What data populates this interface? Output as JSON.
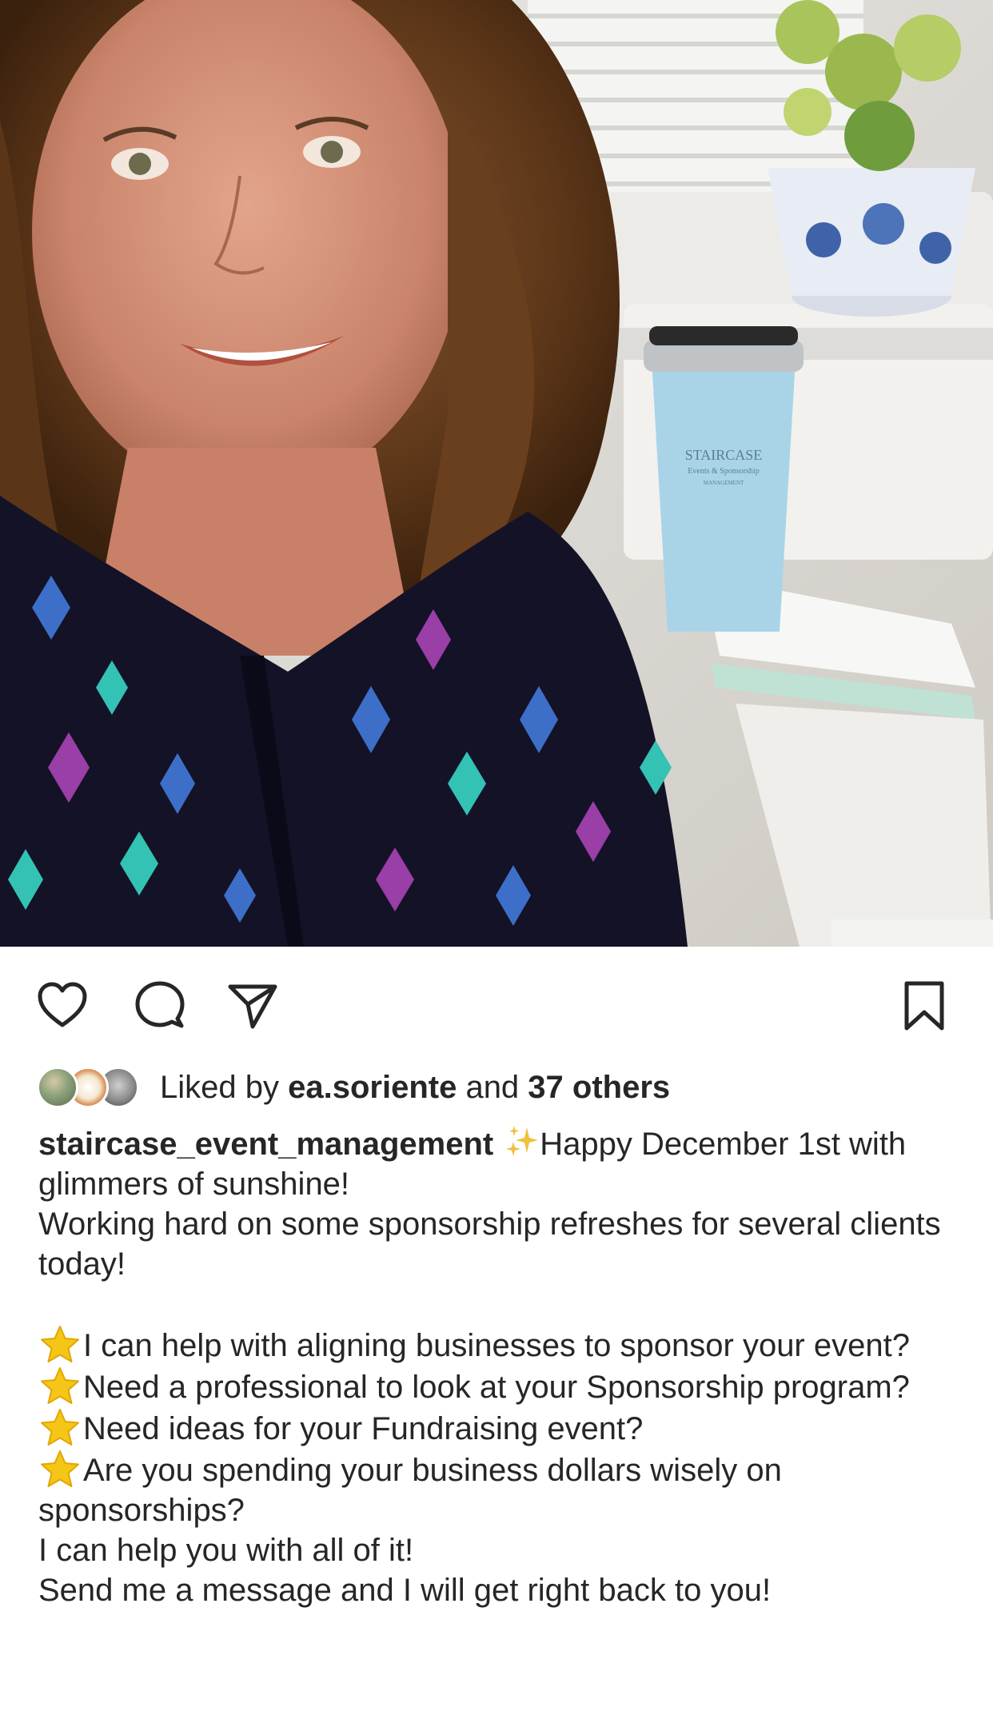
{
  "post": {
    "photo_alt": "",
    "tumbler_brand": "STAIRCASE",
    "tumbler_subline": "Events & Sponsorship",
    "tumbler_footer": "MANAGEMENT"
  },
  "actions": {
    "like_icon": "heart-icon",
    "comment_icon": "comment-icon",
    "share_icon": "paper-plane-icon",
    "save_icon": "bookmark-icon"
  },
  "likes": {
    "prefix": "Liked by ",
    "user": "ea.soriente",
    "middle": " and ",
    "others": "37 others"
  },
  "caption": {
    "username": "staircase_event_management",
    "first_line": "Happy December 1st with glimmers of sunshine!",
    "line2": "Working hard on some sponsorship refreshes for several clients today!",
    "bullets": [
      "I can help with aligning businesses to sponsor your event?",
      "Need a professional to look at your Sponsorship program?",
      "Need ideas for your Fundraising event?",
      "Are you spending your business dollars wisely on sponsorships?"
    ],
    "closing1": "I can help you with all of it!",
    "closing2": "Send me a message and I will get right back to you!"
  },
  "colors": {
    "text": "#262626",
    "background": "#ffffff",
    "star": "#f5c518",
    "sparkle": "#f0c040"
  }
}
